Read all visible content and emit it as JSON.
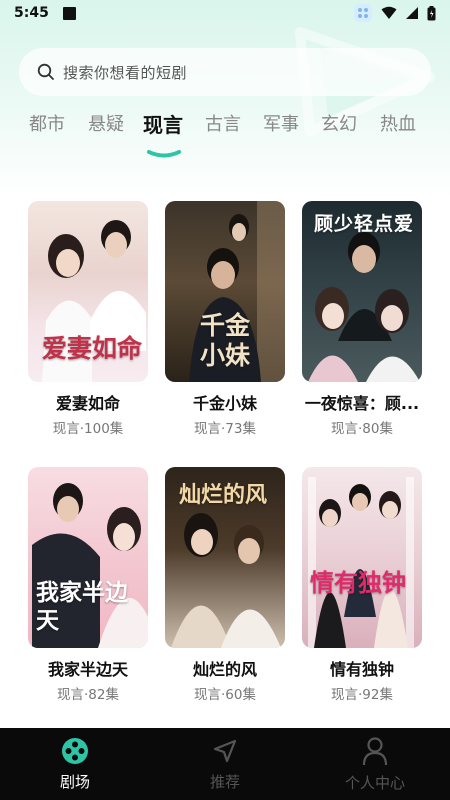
{
  "status_bar": {
    "time": "5:45"
  },
  "search": {
    "placeholder": "搜索你想看的短剧"
  },
  "tabs": [
    {
      "label": "都市",
      "active": false
    },
    {
      "label": "悬疑",
      "active": false
    },
    {
      "label": "现言",
      "active": true
    },
    {
      "label": "古言",
      "active": false
    },
    {
      "label": "军事",
      "active": false
    },
    {
      "label": "玄幻",
      "active": false
    },
    {
      "label": "热血",
      "active": false
    }
  ],
  "accent_color": "#2ec4a6",
  "dramas": [
    {
      "title": "爱妻如命",
      "meta": "现言·100集",
      "poster_text": "爱妻如命"
    },
    {
      "title": "千金小妹",
      "meta": "现言·73集",
      "poster_text": "千金小妹"
    },
    {
      "title": "一夜惊喜：顾...",
      "meta": "现言·80集",
      "poster_text": "顾少轻点爱"
    },
    {
      "title": "我家半边天",
      "meta": "现言·82集",
      "poster_text": "我家半边天"
    },
    {
      "title": "灿烂的风",
      "meta": "现言·60集",
      "poster_text": "灿烂的风"
    },
    {
      "title": "情有独钟",
      "meta": "现言·92集",
      "poster_text": "情有独钟"
    }
  ],
  "bottom_nav": [
    {
      "label": "剧场",
      "icon": "film-reel-icon",
      "active": true
    },
    {
      "label": "推荐",
      "icon": "navigation-arrow-icon",
      "active": false
    },
    {
      "label": "个人中心",
      "icon": "person-icon",
      "active": false
    }
  ]
}
